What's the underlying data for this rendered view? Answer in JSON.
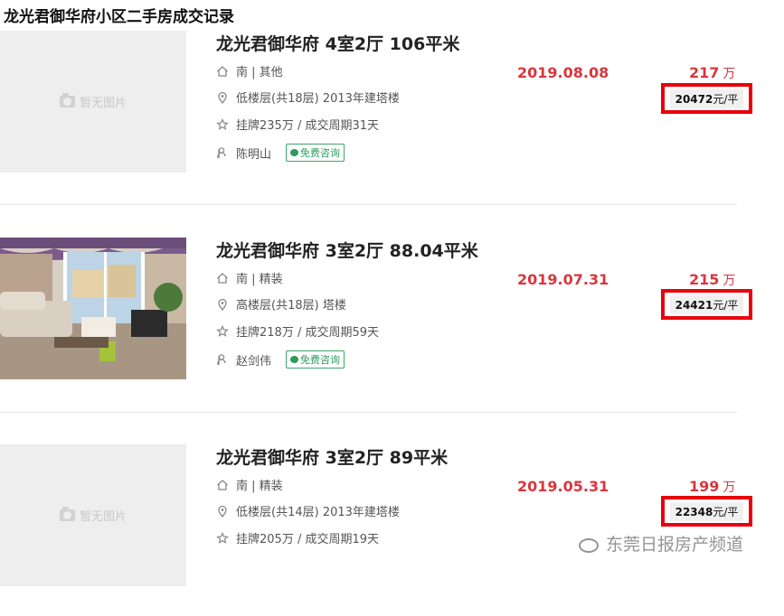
{
  "page_title": "龙光君御华府小区二手房成交记录",
  "placeholder_text": "暂无图片",
  "consult_label": "免费咨询",
  "listings": [
    {
      "title": "龙光君御华府 4室2厅 106平米",
      "orientation": "南 | 其他",
      "floor": "低楼层(共18层) 2013年建塔楼",
      "listing_info": "挂牌235万 / 成交周期31天",
      "agent": "陈明山",
      "deal_date": "2019.08.08",
      "total_price": "217",
      "total_unit": "万",
      "unit_price_value": "20472",
      "unit_price_suffix": "元/平",
      "has_photo": false
    },
    {
      "title": "龙光君御华府 3室2厅 88.04平米",
      "orientation": "南 | 精装",
      "floor": "高楼层(共18层) 塔楼",
      "listing_info": "挂牌218万 / 成交周期59天",
      "agent": "赵剑伟",
      "deal_date": "2019.07.31",
      "total_price": "215",
      "total_unit": "万",
      "unit_price_value": "24421",
      "unit_price_suffix": "元/平",
      "has_photo": true
    },
    {
      "title": "龙光君御华府 3室2厅 89平米",
      "orientation": "南 | 精装",
      "floor": "低楼层(共14层) 2013年建塔楼",
      "listing_info": "挂牌205万 / 成交周期19天",
      "agent": "",
      "deal_date": "2019.05.31",
      "total_price": "199",
      "total_unit": "万",
      "unit_price_value": "22348",
      "unit_price_suffix": "元/平",
      "has_photo": false
    }
  ],
  "watermark_text": "东莞日报房产频道",
  "colors": {
    "price_red": "#d9363e",
    "highlight_box": "#e8000b",
    "consult_green": "#2e9a5c"
  }
}
